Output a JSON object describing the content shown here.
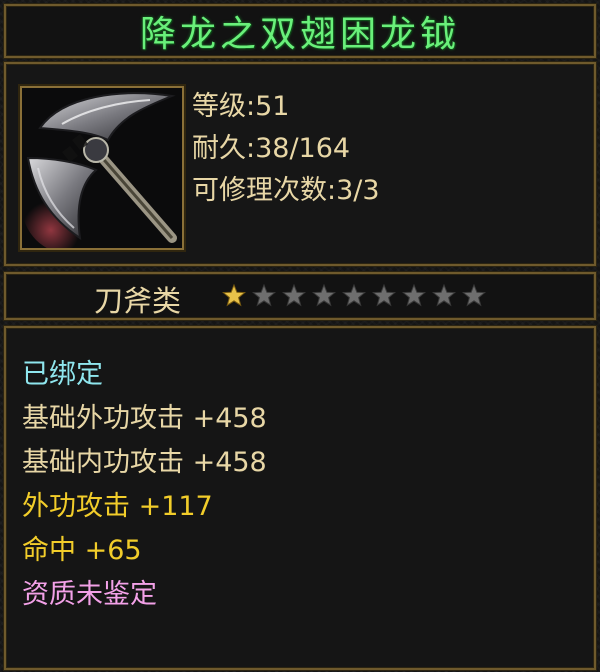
{
  "item": {
    "name": "降龙之双翅困龙钺",
    "icon": "battle-axe-icon",
    "stats": {
      "level": "等级:51",
      "durability": "耐久:38/164",
      "repairs": "可修理次数:3/3"
    },
    "category": "刀斧类",
    "star_rating": {
      "filled": 1,
      "total": 9
    },
    "attributes": [
      {
        "text": "已绑定",
        "color": "#8fe6ee"
      },
      {
        "text": "基础外功攻击 +458",
        "color": "#e8d7a6"
      },
      {
        "text": "基础内功攻击 +458",
        "color": "#e8d7a6"
      },
      {
        "text": "外功攻击 +117",
        "color": "#f2cd2a"
      },
      {
        "text": "命中 +65",
        "color": "#f2cd2a"
      },
      {
        "text": "资质未鉴定",
        "color": "#f3a1e8"
      }
    ]
  },
  "colors": {
    "title": "#69f07a",
    "border": "#6f5a2c",
    "star_filled": "#e8c24a",
    "star_empty": "#6e6e6e"
  }
}
